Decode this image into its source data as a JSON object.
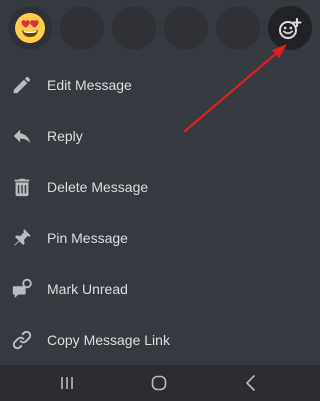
{
  "reactions": [
    {
      "icon": "heart-eyes-emoji-icon",
      "empty": false
    },
    {
      "icon": "",
      "empty": true
    },
    {
      "icon": "",
      "empty": true
    },
    {
      "icon": "",
      "empty": true
    },
    {
      "icon": "",
      "empty": true
    },
    {
      "icon": "add-reaction-icon",
      "empty": false
    }
  ],
  "menu": {
    "items": [
      {
        "label": "Edit Message",
        "icon": "pencil-icon"
      },
      {
        "label": "Reply",
        "icon": "reply-arrow-icon"
      },
      {
        "label": "Delete Message",
        "icon": "trash-icon"
      },
      {
        "label": "Pin Message",
        "icon": "pin-icon"
      },
      {
        "label": "Mark Unread",
        "icon": "mark-unread-icon"
      },
      {
        "label": "Copy Message Link",
        "icon": "link-icon"
      }
    ]
  },
  "nav": {
    "buttons": [
      "recent-apps-icon",
      "home-icon",
      "back-icon"
    ]
  },
  "colors": {
    "background": "#36393f",
    "text": "#dcddde",
    "icon": "#b9bbbe",
    "annotation_arrow": "#e02020"
  }
}
